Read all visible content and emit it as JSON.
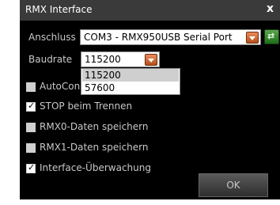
{
  "window": {
    "title": "RMX Interface",
    "close_label": "x"
  },
  "anschluss": {
    "label": "Anschluss",
    "value": "COM3 - RMX950USB Serial Port"
  },
  "baudrate": {
    "label": "Baudrate",
    "value": "115200",
    "options": [
      "115200",
      "57600"
    ],
    "highlighted_option": "115200"
  },
  "checkboxes": [
    {
      "label": "AutoConn",
      "checked": false
    },
    {
      "label": "STOP beim Trennen",
      "checked": true
    },
    {
      "label": "RMX0-Daten speichern",
      "checked": false
    },
    {
      "label": "RMX1-Daten speichern",
      "checked": false
    },
    {
      "label": "Interface-Überwachung",
      "checked": true
    }
  ],
  "ok_label": "OK",
  "icons": {
    "dropdown": "chevron-down-icon",
    "refresh": "refresh-icon",
    "checkmark": "checkmark-icon"
  },
  "colors": {
    "window_bg": "#000000",
    "titlebar_bg": "#3a3a3a",
    "text": "#c8c8c8",
    "dropdown_button": "#c8612a",
    "refresh_button": "#3c8a33"
  }
}
